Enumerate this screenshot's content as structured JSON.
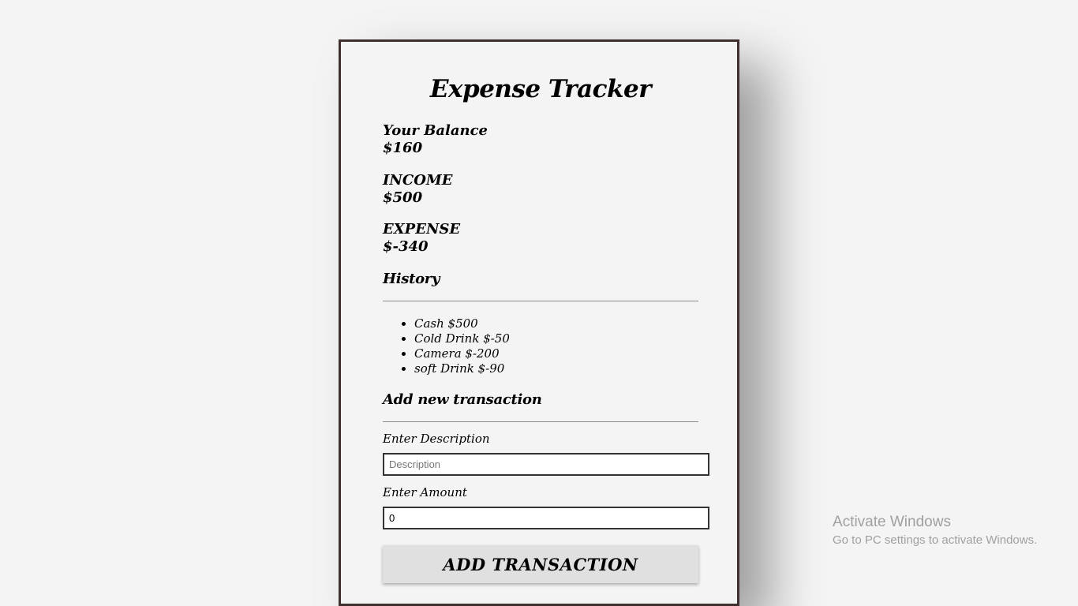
{
  "app": {
    "title": "Expense Tracker"
  },
  "balance": {
    "label": "Your Balance",
    "value": "$160"
  },
  "income": {
    "label": "INCOME",
    "value": "$500"
  },
  "expense": {
    "label": "EXPENSE",
    "value": "$-340"
  },
  "history": {
    "title": "History",
    "items": [
      {
        "label": "Cash $500"
      },
      {
        "label": "Cold Drink $-50"
      },
      {
        "label": "Camera $-200"
      },
      {
        "label": "soft Drink $-90"
      }
    ]
  },
  "form": {
    "title": "Add new transaction",
    "description_label": "Enter Description",
    "description_placeholder": "Description",
    "description_value": "",
    "amount_label": "Enter Amount",
    "amount_value": "0",
    "submit_label": "ADD TRANSACTION"
  },
  "watermark": {
    "title": "Activate Windows",
    "subtitle": "Go to PC settings to activate Windows."
  }
}
